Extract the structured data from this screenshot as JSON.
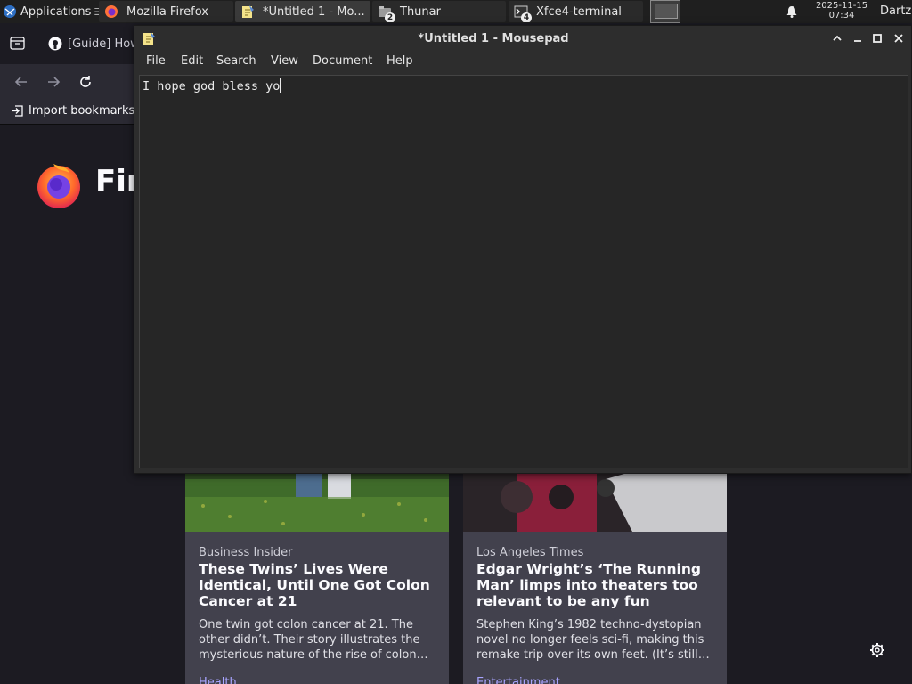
{
  "taskbar": {
    "applications_label": "Applications",
    "windows": [
      {
        "label": "Mozilla Firefox",
        "icon": "firefox-icon"
      },
      {
        "label": "*Untitled 1 - Mo...",
        "icon": "mousepad-icon",
        "active": true
      },
      {
        "label": "Thunar",
        "icon": "folder-icon",
        "badge": "2"
      },
      {
        "label": "Xfce4-terminal",
        "icon": "terminal-icon",
        "badge": "4"
      }
    ],
    "clock_date": "2025-11-15",
    "clock_time": "07:34",
    "user": "Dartz"
  },
  "firefox": {
    "tab_title": "[Guide] How",
    "bookmarks_import": "Import bookmarks",
    "logo_text": "Fire",
    "cards": [
      {
        "source": "Business Insider",
        "title": "These Twins’ Lives Were Identical, Until One Got Colon Cancer at 21",
        "description": "One twin got colon cancer at 21. The other didn’t. Their story illustrates the mysterious nature of the rise of colon…",
        "tag": "Health"
      },
      {
        "source": "Los Angeles Times",
        "title": "Edgar Wright’s ‘The Running Man’ limps into theaters too relevant to be any fun",
        "description": "Stephen King’s 1982 techno-dystopian novel no longer feels sci-fi, making this remake trip over its own feet. (It’s still…",
        "tag": "Entertainment"
      }
    ]
  },
  "mousepad": {
    "title": "*Untitled 1 - Mousepad",
    "menu": [
      "File",
      "Edit",
      "Search",
      "View",
      "Document",
      "Help"
    ],
    "content": "I hope god bless yo"
  },
  "colors": {
    "taskbar_bg": "#1f1f1f",
    "firefox_bg": "#1c1b22",
    "card_bg": "#42414d",
    "link_accent": "#a8a4ff",
    "editor_bg": "#262626"
  }
}
